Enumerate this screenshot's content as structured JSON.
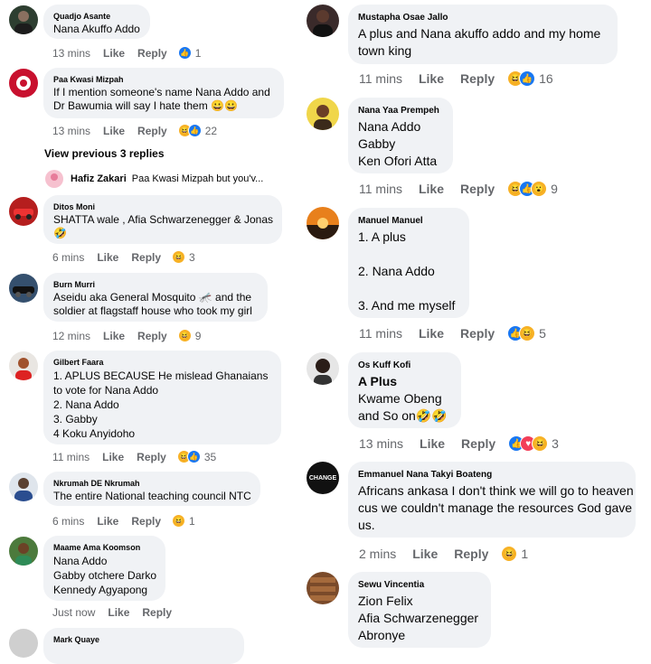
{
  "actions": {
    "like": "Like",
    "reply": "Reply"
  },
  "left_comments": [
    {
      "author": "Quadjo Asante",
      "text": "Nana Akuffo Addo",
      "time": "13 mins",
      "reactions": [
        "like"
      ],
      "count": "1"
    },
    {
      "author": "Paa Kwasi Mizpah",
      "text": "If I mention someone's name  Nana Addo and Dr Bawumia will say I hate them 😀😀",
      "time": "13 mins",
      "reactions": [
        "haha",
        "like"
      ],
      "count": "22"
    },
    {
      "author": "Ditos Moni",
      "text": "SHATTA wale  , Afia Schwarzenegger & Jonas 🤣",
      "time": "6 mins",
      "reactions": [
        "haha"
      ],
      "count": "3"
    },
    {
      "author": "Burn Murri",
      "text": "Aseidu aka General Mosquito 🦟  and the soldier at flagstaff house who took my girl",
      "time": "12 mins",
      "reactions": [
        "haha"
      ],
      "count": "9"
    },
    {
      "author": "Gilbert Faara",
      "text": "1. APLUS BECAUSE He mislead Ghanaians to vote for Nana Addo\n2. Nana Addo\n3. Gabby\n4 Koku Anyidoho",
      "time": "11 mins",
      "reactions": [
        "haha",
        "like"
      ],
      "count": "35"
    },
    {
      "author": "Nkrumah DE Nkrumah",
      "text": "The entire National teaching council NTC",
      "time": "6 mins",
      "reactions": [
        "haha"
      ],
      "count": "1"
    },
    {
      "author": "Maame Ama Koomson",
      "text": "Nana Addo\nGabby otchere Darko\nKennedy Agyapong",
      "time": "Just now",
      "reactions": [],
      "count": ""
    },
    {
      "author": "Mark Quaye",
      "text": "",
      "time": "",
      "reactions": [],
      "count": ""
    }
  ],
  "view_previous": "View previous 3 replies",
  "reply_preview": {
    "author": "Hafiz Zakari",
    "text": "Paa Kwasi Mizpah but you'v..."
  },
  "right_comments": [
    {
      "author": "Mustapha Osae Jallo",
      "text": "A plus and Nana akuffo addo and my home town king",
      "time": "11 mins",
      "reactions": [
        "haha",
        "like"
      ],
      "count": "16"
    },
    {
      "author": "Nana Yaa Prempeh",
      "text": "Nana Addo\nGabby\nKen Ofori Atta",
      "time": "11 mins",
      "reactions": [
        "haha",
        "like",
        "wow"
      ],
      "count": "9"
    },
    {
      "author": "Manuel Manuel",
      "text": "1. A plus\n\n2. Nana Addo\n\n3. And me myself",
      "time": "11 mins",
      "reactions": [
        "like",
        "haha"
      ],
      "count": "5"
    },
    {
      "author": "Os Kuff Kofi",
      "text": "A Plus",
      "text2": "Kwame Obeng\nand So on🤣🤣",
      "time": "13 mins",
      "reactions": [
        "like",
        "love",
        "haha"
      ],
      "count": "3"
    },
    {
      "author": "Emmanuel Nana Takyi Boateng",
      "text": "Africans ankasa I don't think we will go to heaven cus we couldn't manage the resources God gave us.",
      "time": "2 mins",
      "reactions": [
        "haha"
      ],
      "count": "1"
    },
    {
      "author": "Sewu Vincentia",
      "text": "Zion Felix\nAfia Schwarzenegger\nAbronye",
      "time": "",
      "reactions": [],
      "count": ""
    }
  ],
  "avatar_text": {
    "emmanuel": "CHANGE"
  },
  "colors": {
    "bubble": "#f0f2f5",
    "meta": "#65676b",
    "like_blue": "#1877f2",
    "haha_yellow": "#f7b125",
    "love_red": "#f33e58"
  }
}
